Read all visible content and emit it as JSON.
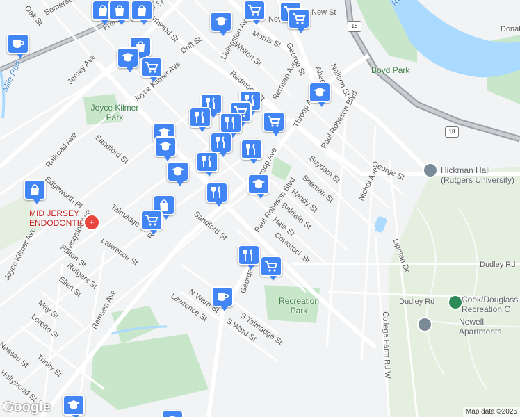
{
  "map": {
    "streets": [
      "Somerset St",
      "Oak St",
      "French St",
      "Suydam St",
      "Townsend St",
      "Drift St",
      "Livingston Ave",
      "Welton St",
      "Morris St",
      "New St",
      "Redmond St",
      "Remsen Ave",
      "George St",
      "Abeel St",
      "Neilson St",
      "Jersey Ave",
      "Joyce Kilmer Ave",
      "Throop Ave",
      "Paul Robeson Blvd",
      "Sandford St",
      "Railroad Ave",
      "Edgeworth Pl",
      "Talmadge St",
      "Suydam St",
      "Seaman St",
      "Handy St",
      "Baldwin St",
      "Hale St",
      "Comstock St",
      "Nichol Ave",
      "Lawrence St",
      "Fulton St",
      "Rutgers St",
      "Ellen St",
      "May St",
      "Loretto St",
      "Nassau St",
      "Trinity St",
      "Hollywood St",
      "N Ward St",
      "S Talmadge St",
      "S Ward St",
      "Dudley Rd",
      "Lipman Dr",
      "College Farm Rd W",
      "Donald"
    ],
    "pois": {
      "park1": "Joyce Kilmer Park",
      "park2": "Boyd Park",
      "park3": "Recreation Park",
      "hospital": "MID JERSEY ENDODONTIC...",
      "university": "Hickman Hall (Rutgers University)",
      "recreation": "Cook/Douglass Recreation C",
      "apartments": "Newell Apartments",
      "river": "Raritan River",
      "run": "Mile Run"
    },
    "highway_shield": "18",
    "highway_shield2": "18",
    "brand": "Google",
    "attribution": "Map data ©2025",
    "colors": {
      "water": "#aadaff",
      "park": "#c8e6c9",
      "marker": "#4285f4",
      "road": "#ffffff",
      "highway": "#9aa0a6"
    }
  }
}
